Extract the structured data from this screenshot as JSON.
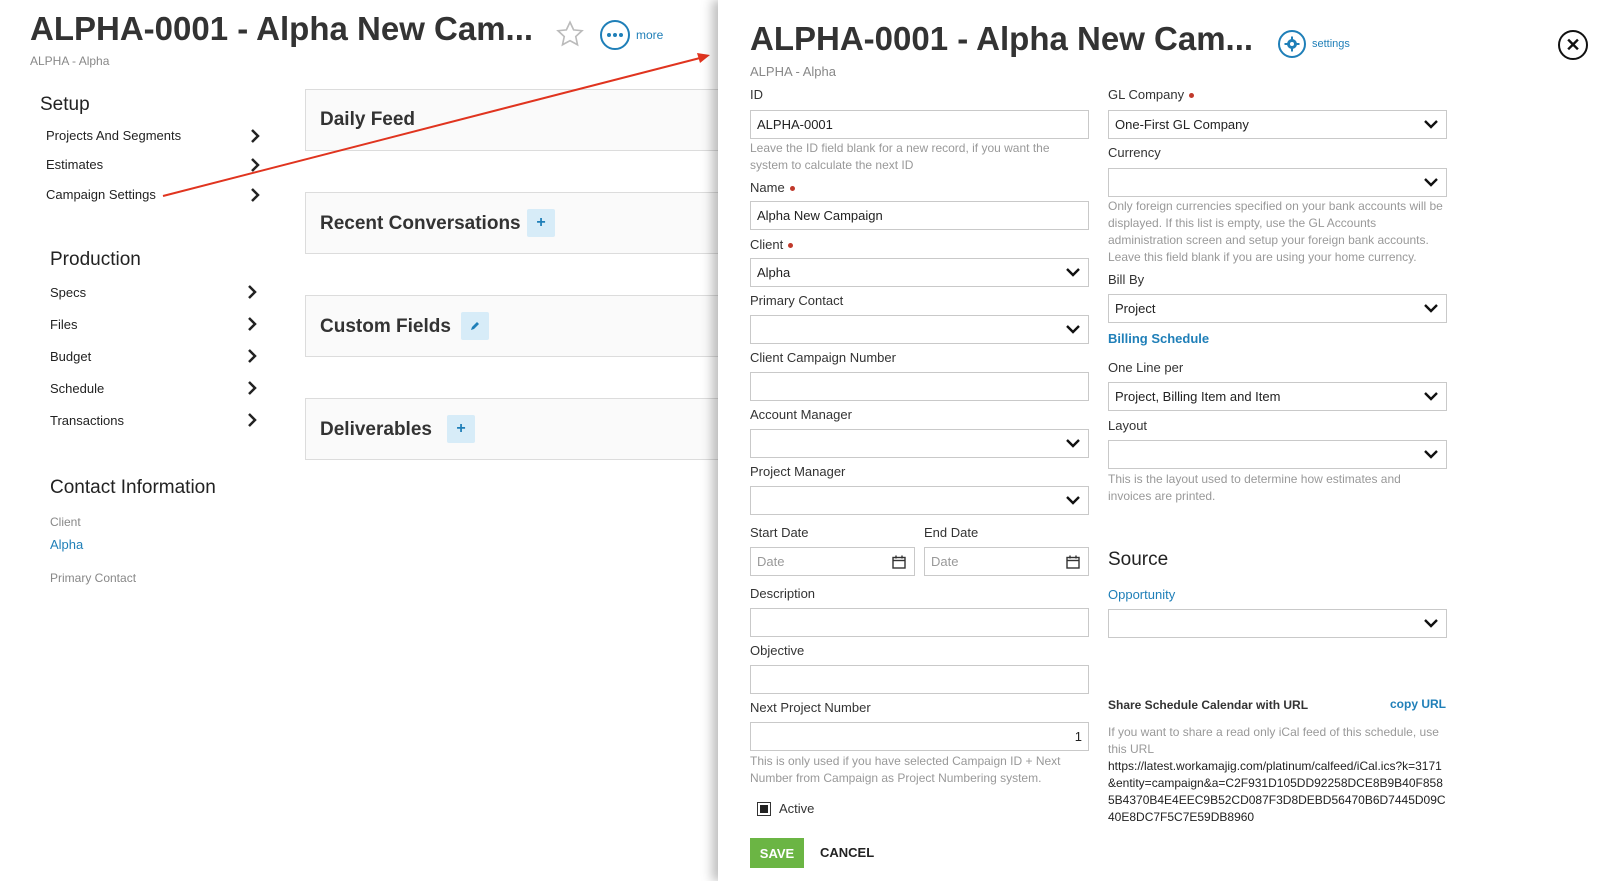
{
  "background": {
    "title": "ALPHA-0001 - Alpha New Cam...",
    "subtitle": "ALPHA - Alpha",
    "more_label": "more",
    "setup": {
      "heading": "Setup",
      "items": [
        "Projects And Segments",
        "Estimates",
        "Campaign Settings"
      ]
    },
    "production": {
      "heading": "Production",
      "items": [
        "Specs",
        "Files",
        "Budget",
        "Schedule",
        "Transactions"
      ]
    },
    "contact": {
      "heading": "Contact Information",
      "client_label": "Client",
      "client_value": "Alpha",
      "primary_contact_label": "Primary Contact"
    },
    "cards": {
      "daily_feed": "Daily Feed",
      "recent_conversations": "Recent Conversations",
      "custom_fields": "Custom Fields",
      "deliverables": "Deliverables"
    }
  },
  "panel": {
    "title": "ALPHA-0001 - Alpha New Cam...",
    "subtitle": "ALPHA - Alpha",
    "settings_label": "settings",
    "left": {
      "id_label": "ID",
      "id_value": "ALPHA-0001",
      "id_help": "Leave the ID field blank for a new record, if you want the system to calculate the next ID",
      "name_label": "Name",
      "name_value": "Alpha New Campaign",
      "client_label": "Client",
      "client_value": "Alpha",
      "primary_contact_label": "Primary Contact",
      "client_campaign_number_label": "Client Campaign Number",
      "account_manager_label": "Account Manager",
      "project_manager_label": "Project Manager",
      "start_date_label": "Start Date",
      "start_date_placeholder": "Date",
      "end_date_label": "End Date",
      "end_date_placeholder": "Date",
      "description_label": "Description",
      "objective_label": "Objective",
      "next_project_number_label": "Next Project Number",
      "next_project_number_value": "1",
      "next_project_help": "This is only used if you have selected Campaign ID + Next Number from Campaign as Project Numbering system.",
      "active_label": "Active"
    },
    "right": {
      "gl_company_label": "GL Company",
      "gl_company_value": "One-First GL Company",
      "currency_label": "Currency",
      "currency_help": "Only foreign currencies specified on your bank accounts will be displayed. If this list is empty, use the GL Accounts administration screen and setup your foreign bank accounts. Leave this field blank if you are using your home currency.",
      "bill_by_label": "Bill By",
      "bill_by_value": "Project",
      "billing_schedule_link": "Billing Schedule",
      "one_line_per_label": "One Line per",
      "one_line_per_value": "Project, Billing Item and Item",
      "layout_label": "Layout",
      "layout_help": "This is the layout used to determine how estimates and invoices are printed.",
      "source_heading": "Source",
      "opportunity_link": "Opportunity",
      "share_label": "Share Schedule Calendar with URL",
      "copy_url_link": "copy URL",
      "share_help": "If you want to share a read only iCal feed of this schedule, use this URL",
      "share_url": "https://latest.workamajig.com/platinum/calfeed/iCal.ics?k=3171&entity=campaign&a=C2F931D105DD92258DCE8B9B40F8585B4370B4E4EEC9B52CD087F3D8DEBD56470B6D7445D09C40E8DC7F5C7E59DB8960"
    },
    "save_label": "SAVE",
    "cancel_label": "CANCEL"
  }
}
